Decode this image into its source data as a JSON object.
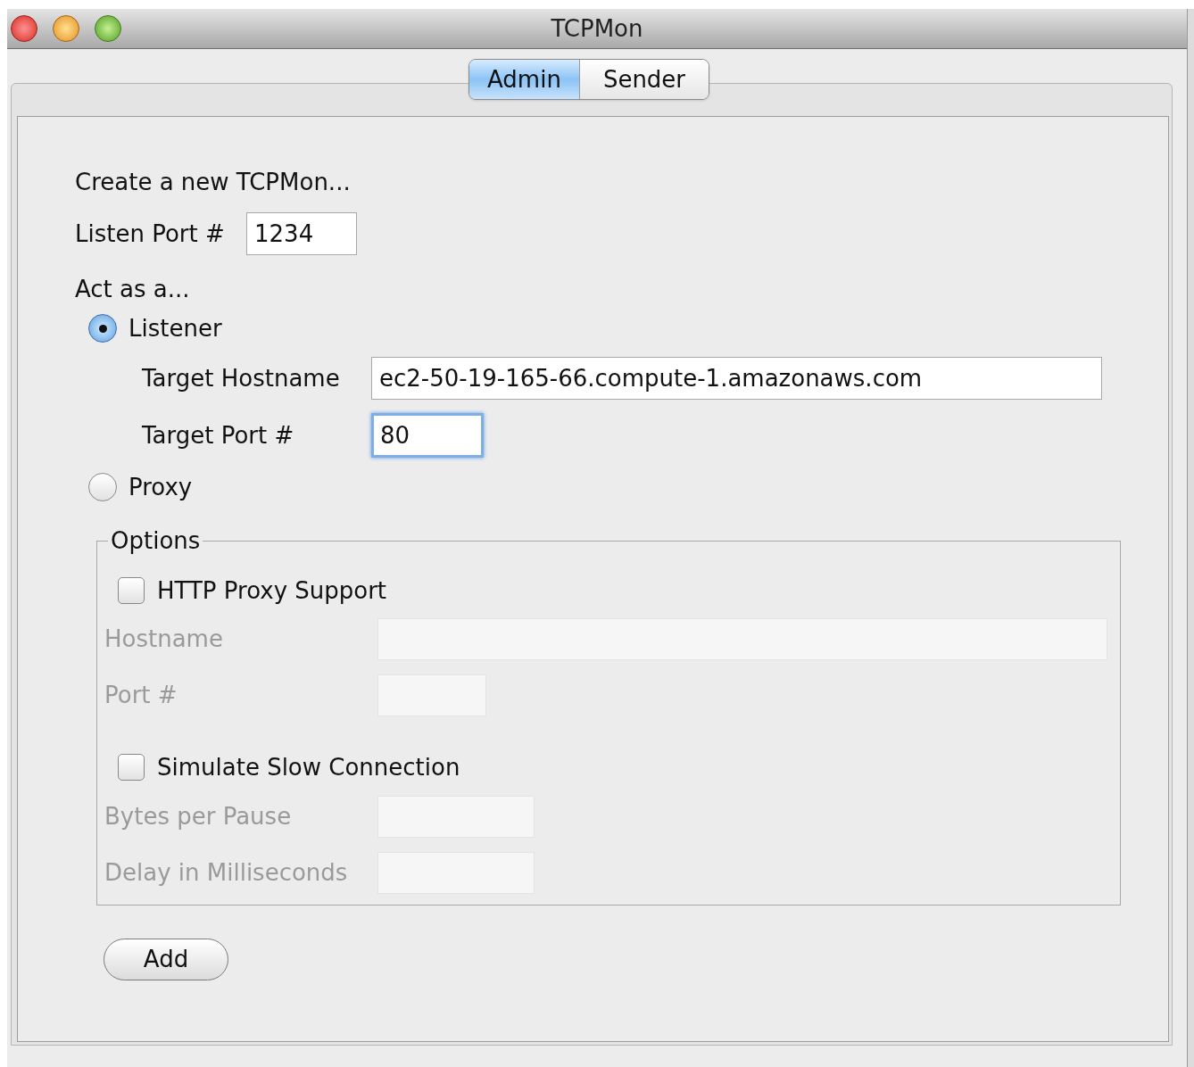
{
  "window": {
    "title": "TCPMon"
  },
  "tabs": [
    {
      "label": "Admin",
      "selected": true
    },
    {
      "label": "Sender",
      "selected": false
    }
  ],
  "heading": "Create a new TCPMon...",
  "listen_port": {
    "label": "Listen Port #",
    "value": "1234"
  },
  "act_as": {
    "label": "Act as a...",
    "modes": [
      {
        "label": "Listener",
        "selected": true,
        "fields": [
          {
            "label": "Target Hostname",
            "value": "ec2-50-19-165-66.compute-1.amazonaws.com",
            "focused": false
          },
          {
            "label": "Target Port #",
            "value": "80",
            "focused": true
          }
        ]
      },
      {
        "label": "Proxy",
        "selected": false
      }
    ]
  },
  "options": {
    "title": "Options",
    "groups": [
      {
        "label": "HTTP Proxy Support",
        "checked": false,
        "fields": [
          {
            "label": "Hostname",
            "disabled": true
          },
          {
            "label": "Port #",
            "disabled": true
          }
        ]
      },
      {
        "label": "Simulate Slow Connection",
        "checked": false,
        "fields": [
          {
            "label": "Bytes per Pause",
            "disabled": true
          },
          {
            "label": "Delay in Milliseconds",
            "disabled": true
          }
        ]
      }
    ]
  },
  "add_button": "Add"
}
